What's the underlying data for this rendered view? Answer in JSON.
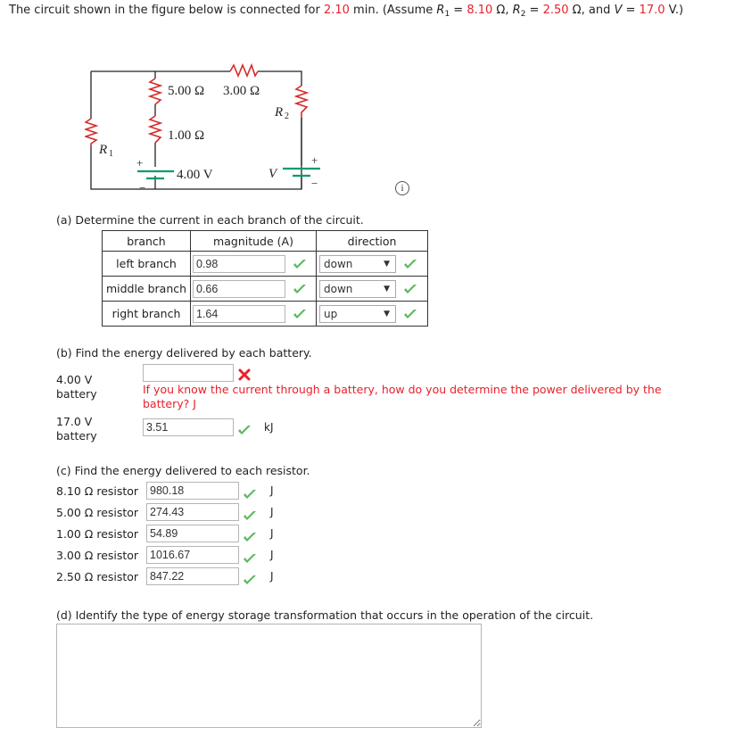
{
  "problem": {
    "intro_a": "The circuit shown in the figure below is connected for ",
    "time": "2.10",
    "intro_b": " min. (Assume ",
    "r1_label": "R",
    "r1_sub": "1",
    "eq1": " = ",
    "r1_value": "8.10",
    "ohm_comma1": " Ω, ",
    "r2_label": "R",
    "r2_sub": "2",
    "eq2": " = ",
    "r2_value": "2.50",
    "ohm_comma2": " Ω, and ",
    "v_label": "V",
    "eq3": " = ",
    "v_value": "17.0",
    "end": " V.)"
  },
  "figure": {
    "labels": {
      "r5": "5.00 Ω",
      "r3": "3.00 Ω",
      "r1": "1.00 Ω",
      "R1": "R",
      "R1_sub": "1",
      "R2": "R",
      "R2_sub": "2",
      "bat4": "4.00 V",
      "V": "V",
      "plus": "+",
      "minus": "−"
    },
    "colors": {
      "resistor": "#d42b2b",
      "battery": "#0a9a73",
      "wire": "#222222"
    }
  },
  "info_icon": "i",
  "part_a": {
    "prompt": "(a) Determine the current in each branch of the circuit.",
    "headers": [
      "branch",
      "magnitude (A)",
      "direction"
    ],
    "rows": [
      {
        "branch": "left branch",
        "magnitude": "0.98",
        "direction": "down"
      },
      {
        "branch": "middle branch",
        "magnitude": "0.66",
        "direction": "down"
      },
      {
        "branch": "right branch",
        "magnitude": "1.64",
        "direction": "up"
      }
    ],
    "dropdown_arrow": "▼"
  },
  "part_b": {
    "prompt": "(b) Find the energy delivered by each battery.",
    "battery1_label_1": "4.00 V",
    "battery1_label_2": "battery",
    "battery1_value": "",
    "hint_line1": "If you know the current through a battery, how do you determine the power delivered by the",
    "hint_line2": "battery? J",
    "battery2_label_1": "17.0 V",
    "battery2_label_2": "battery",
    "battery2_value": "3.51",
    "battery2_unit": "kJ"
  },
  "part_c": {
    "prompt": "(c) Find the energy delivered to each resistor.",
    "rows": [
      {
        "label": "8.10 Ω resistor",
        "value": "980.18",
        "unit": "J"
      },
      {
        "label": "5.00 Ω resistor",
        "value": "274.43",
        "unit": "J"
      },
      {
        "label": "1.00 Ω resistor",
        "value": "54.89",
        "unit": "J"
      },
      {
        "label": "3.00 Ω resistor",
        "value": "1016.67",
        "unit": "J"
      },
      {
        "label": "2.50 Ω resistor",
        "value": "847.22",
        "unit": "J"
      }
    ]
  },
  "part_d": {
    "prompt": "(d) Identify the type of energy storage transformation that occurs in the operation of the circuit.",
    "answer": ""
  },
  "colors": {
    "given_value": "#e8202a",
    "correct": "#5cb85c",
    "incorrect": "#e8202a",
    "hint": "#e8202a"
  }
}
